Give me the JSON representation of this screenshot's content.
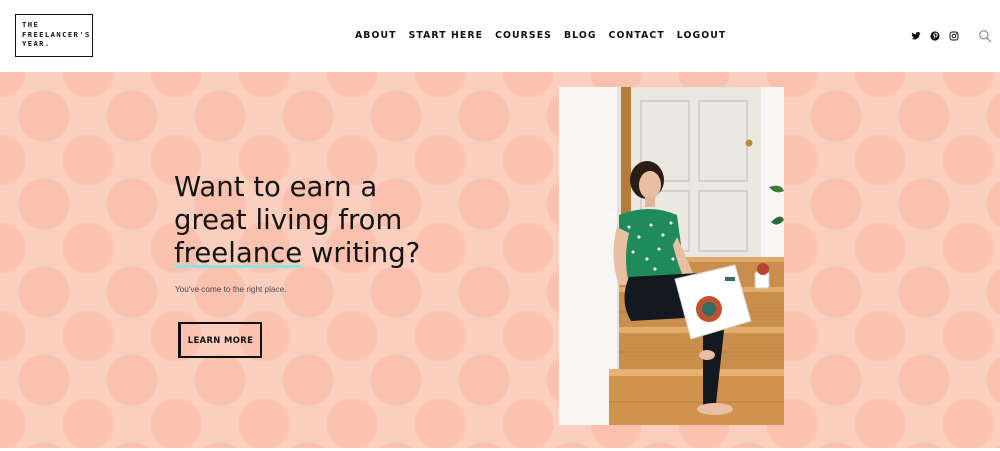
{
  "brand": {
    "logo_lines": [
      "THE",
      "FREELANCER'S",
      "YEAR."
    ]
  },
  "nav": {
    "items": [
      "ABOUT",
      "START HERE",
      "COURSES",
      "BLOG",
      "CONTACT",
      "LOGOUT"
    ]
  },
  "social": {
    "icons": [
      "twitter-icon",
      "pinterest-icon",
      "instagram-icon",
      "search-icon"
    ]
  },
  "hero": {
    "headline_line1": "Want to earn a",
    "headline_line2": "great living from",
    "headline_highlight": "freelance",
    "headline_line3_rest": " writing?",
    "subtitle": "You've come to the right place.",
    "cta_label": "LEARN MORE"
  },
  "colors": {
    "hero_bg": "#fbcfbf",
    "polka_dot": "#f8b6a0",
    "highlight_underline": "#8fe3dc",
    "text": "#111111"
  }
}
